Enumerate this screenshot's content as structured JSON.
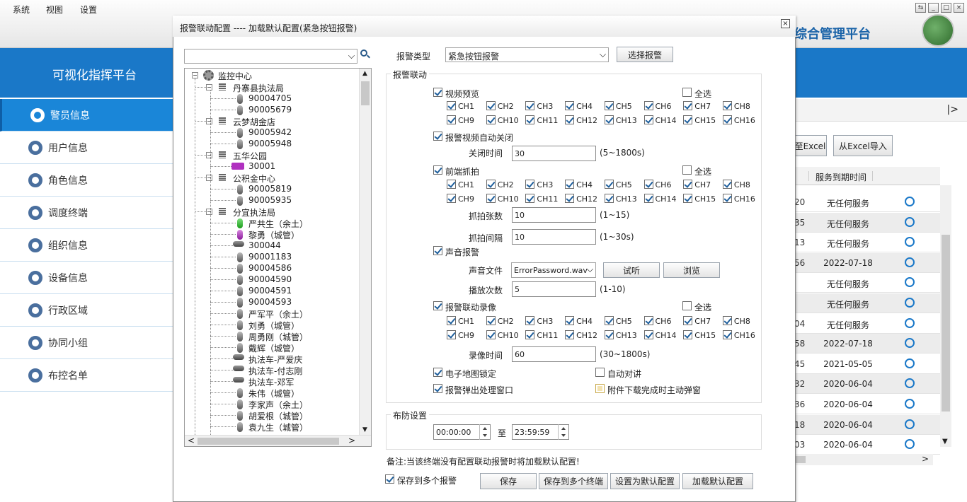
{
  "menubar": {
    "items": [
      "系统",
      "视图",
      "设置"
    ]
  },
  "app": {
    "title": "综合管理平台",
    "platform": "可视化指挥平台"
  },
  "sidebar": {
    "items": [
      "警员信息",
      "用户信息",
      "角色信息",
      "调度终端",
      "组织信息",
      "设备信息",
      "行政区域",
      "协同小组",
      "布控名单"
    ]
  },
  "background_panel": {
    "export_label": "至Excel",
    "import_label": "从Excel导入",
    "column_header": "服务到期时间",
    "rows": [
      {
        "id": "20",
        "expire": "无任何服务"
      },
      {
        "id": "35",
        "expire": "无任何服务"
      },
      {
        "id": "13",
        "expire": "无任何服务"
      },
      {
        "id": "56",
        "expire": "2022-07-18"
      },
      {
        "id": "",
        "expire": "无任何服务"
      },
      {
        "id": "",
        "expire": "无任何服务"
      },
      {
        "id": "04",
        "expire": "无任何服务"
      },
      {
        "id": "58",
        "expire": "2022-07-18"
      },
      {
        "id": "45",
        "expire": "2021-05-05"
      },
      {
        "id": "32",
        "expire": "2020-06-04"
      },
      {
        "id": "36",
        "expire": "2020-06-04"
      },
      {
        "id": "18",
        "expire": "2020-06-04"
      },
      {
        "id": "03",
        "expire": "2020-06-04"
      }
    ]
  },
  "dialog": {
    "title": "报警联动配置 ---- 加载默认配置(紧急按钮报警)",
    "alarm_type_label": "报警类型",
    "alarm_type_value": "紧急按钮报警",
    "select_alarm_button": "选择报警",
    "linkage_group": "报警联动",
    "video_preview": "视频预览",
    "select_all": "全选",
    "channels": [
      "CH1",
      "CH2",
      "CH3",
      "CH4",
      "CH5",
      "CH6",
      "CH7",
      "CH8",
      "CH9",
      "CH10",
      "CH11",
      "CH12",
      "CH13",
      "CH14",
      "CH15",
      "CH16"
    ],
    "auto_close": "报警视频自动关闭",
    "close_time_label": "关闭时间",
    "close_time_value": "30",
    "close_time_range": "(5~1800s)",
    "snapshot": "前端抓拍",
    "snap_count_label": "抓拍张数",
    "snap_count_value": "10",
    "snap_count_range": "(1~15)",
    "snap_interval_label": "抓拍间隔",
    "snap_interval_value": "10",
    "snap_interval_range": "(1~30s)",
    "sound_alarm": "声音报警",
    "sound_file_label": "声音文件",
    "sound_file_value": "ErrorPassword.wav",
    "listen_button": "试听",
    "browse_button": "浏览",
    "play_count_label": "播放次数",
    "play_count_value": "5",
    "play_count_range": "(1-10)",
    "record": "报警联动录像",
    "record_time_label": "录像时间",
    "record_time_value": "60",
    "record_time_range": "(30~1800s)",
    "map_lock": "电子地图锁定",
    "auto_talk": "自动对讲",
    "popup": "报警弹出处理窗口",
    "attach_popup": "附件下载完成时主动弹窗",
    "defense_group": "布防设置",
    "time_start": "00:00:00",
    "time_to": "至",
    "time_end": "23:59:59",
    "note": "备注:当该终端没有配置联动报警时将加载默认配置!",
    "save_multi_alarm": "保存到多个报警",
    "save_button": "保存",
    "save_multi_terminal_button": "保存到多个终端",
    "set_default_button": "设置为默认配置",
    "load_default_button": "加载默认配置"
  },
  "tree": {
    "root": "监控中心",
    "nodes": [
      {
        "label": "丹寨县执法局",
        "kind": "group",
        "level": 1
      },
      {
        "label": "90004705",
        "kind": "dev",
        "level": 2
      },
      {
        "label": "90005679",
        "kind": "dev",
        "level": 2
      },
      {
        "label": "云梦胡金店",
        "kind": "group",
        "level": 1
      },
      {
        "label": "90005942",
        "kind": "dev",
        "level": 2
      },
      {
        "label": "90005948",
        "kind": "dev",
        "level": 2
      },
      {
        "label": "五华公园",
        "kind": "group",
        "level": 1
      },
      {
        "label": "30001",
        "kind": "car",
        "level": 2
      },
      {
        "label": "公积金中心",
        "kind": "group",
        "level": 1
      },
      {
        "label": "90005819",
        "kind": "dev",
        "level": 2
      },
      {
        "label": "90005935",
        "kind": "dev",
        "level": 2
      },
      {
        "label": "分宜执法局",
        "kind": "group",
        "level": 1
      },
      {
        "label": "严共生（余土）",
        "kind": "green",
        "level": 2
      },
      {
        "label": "黎勇（城管）",
        "kind": "purple",
        "level": 2
      },
      {
        "label": "300044",
        "kind": "wide",
        "level": 2
      },
      {
        "label": "90001183",
        "kind": "dev",
        "level": 2
      },
      {
        "label": "90004586",
        "kind": "dev",
        "level": 2
      },
      {
        "label": "90004590",
        "kind": "dev",
        "level": 2
      },
      {
        "label": "90004591",
        "kind": "dev",
        "level": 2
      },
      {
        "label": "90004593",
        "kind": "dev",
        "level": 2
      },
      {
        "label": "严军平（余土）",
        "kind": "dev",
        "level": 2
      },
      {
        "label": "刘勇（城管）",
        "kind": "dev",
        "level": 2
      },
      {
        "label": "周勇刚（城管）",
        "kind": "dev",
        "level": 2
      },
      {
        "label": "戴辉（城管）",
        "kind": "dev",
        "level": 2
      },
      {
        "label": "执法车-严爱庆",
        "kind": "wide",
        "level": 2
      },
      {
        "label": "执法车-付志刚",
        "kind": "wide",
        "level": 2
      },
      {
        "label": "执法车-邓军",
        "kind": "wide",
        "level": 2
      },
      {
        "label": "朱伟（城管）",
        "kind": "dev",
        "level": 2
      },
      {
        "label": "李家声（余土）",
        "kind": "dev",
        "level": 2
      },
      {
        "label": "胡爱根（城管）",
        "kind": "dev",
        "level": 2
      },
      {
        "label": "袁九生（城管）",
        "kind": "dev",
        "level": 2
      }
    ]
  }
}
